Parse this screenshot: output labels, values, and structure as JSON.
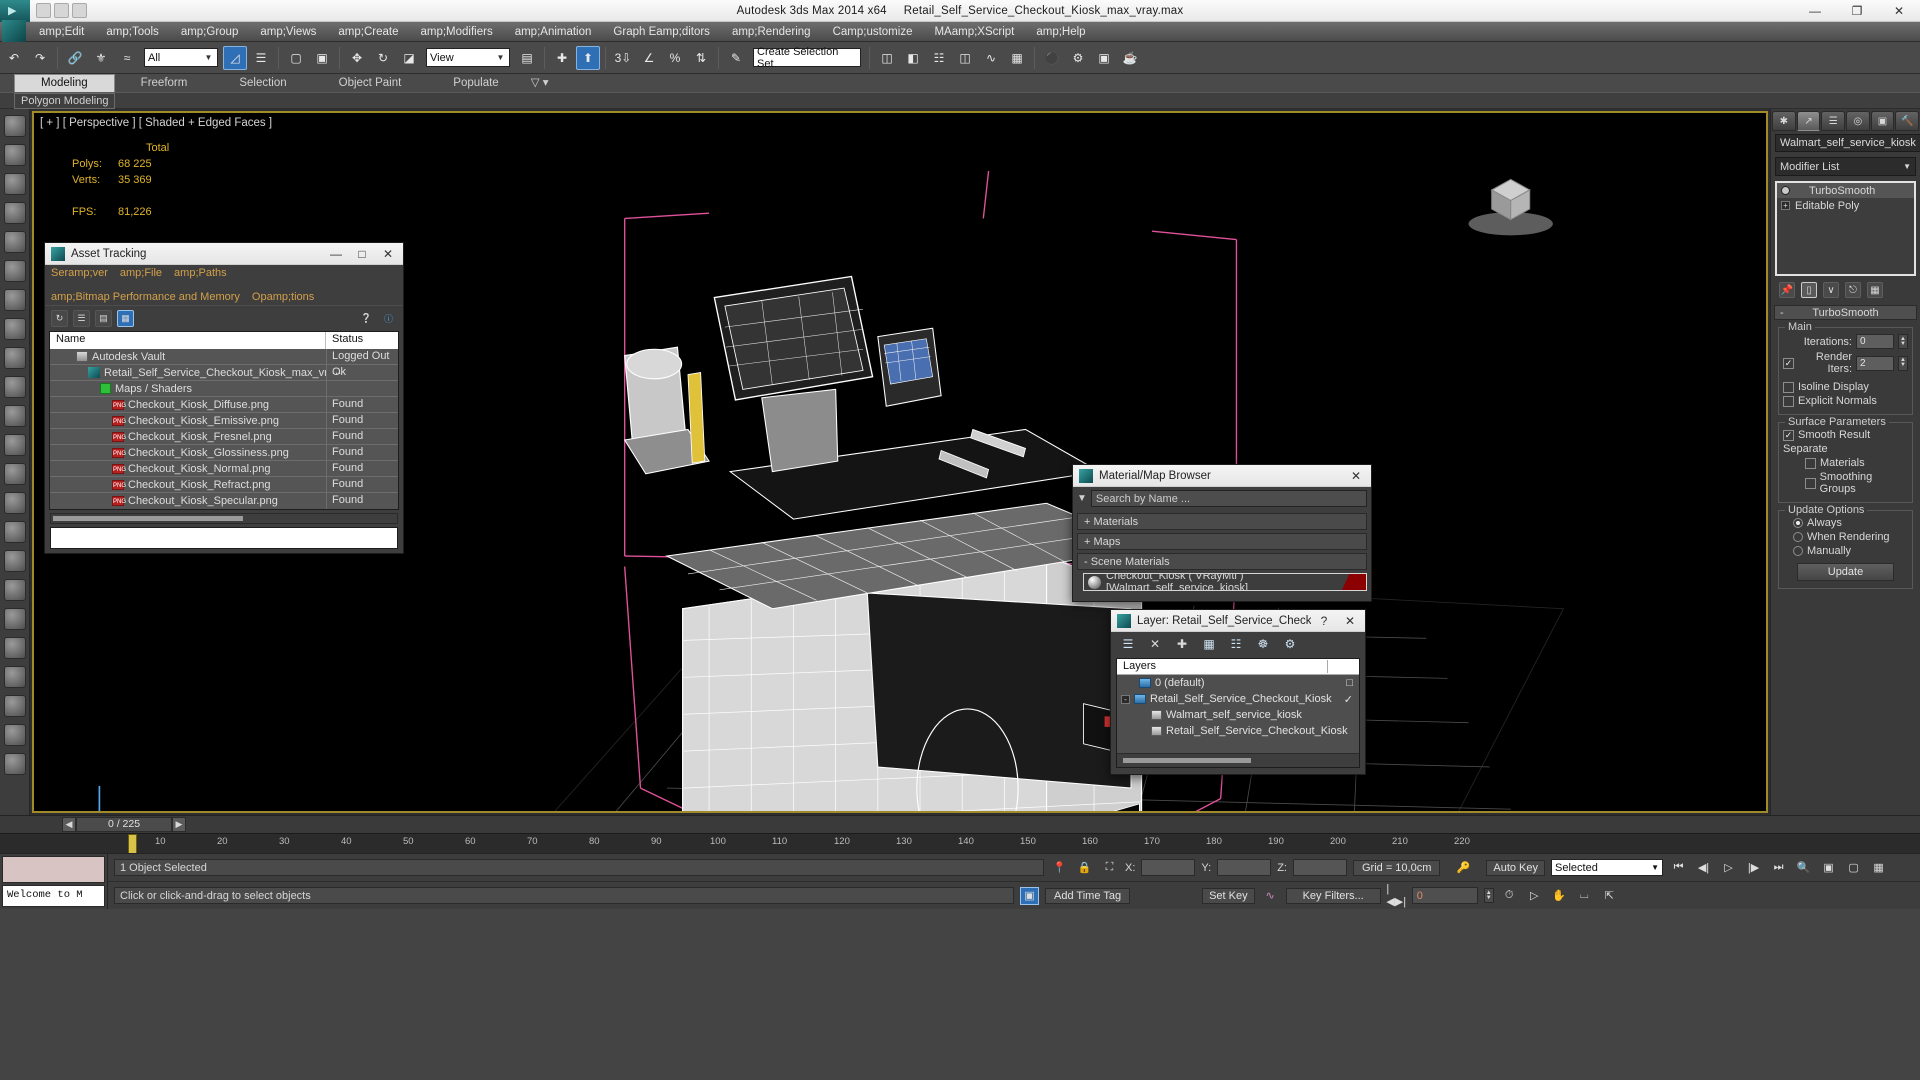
{
  "titlebar": {
    "app_name": "Autodesk 3ds Max  2014 x64",
    "file_name": "Retail_Self_Service_Checkout_Kiosk_max_vray.max",
    "minimize": "—",
    "maximize": "❐",
    "close": "✕"
  },
  "menubar": {
    "items": [
      "amp;Edit",
      "amp;Tools",
      "amp;Group",
      "amp;Views",
      "amp;Create",
      "amp;Modifiers",
      "amp;Animation",
      "Graph Eamp;ditors",
      "amp;Rendering",
      "Camp;ustomize",
      "MAamp;XScript",
      "amp;Help"
    ]
  },
  "toolbar": {
    "selection_filter": "All",
    "reference_coord": "View",
    "named_selection_sets": "Create Selection Set",
    "undo": "undo-icon",
    "redo": "redo-icon",
    "select_link": "link-icon",
    "unlink": "unlink-icon",
    "bind_space_warp": "bind-space-warp-icon",
    "select_object": "select-object-icon",
    "select_by_name": "select-by-name-icon",
    "select_region": "select-region-icon",
    "window_crossing": "window-crossing-icon",
    "select_move": "select-and-move-icon",
    "select_rotate": "select-and-rotate-icon",
    "select_scale": "select-and-scale-icon",
    "use_center": "use-pivot-center-icon",
    "select_manipulate": "select-and-manipulate-icon",
    "snap_toggle": "snaps-toggle-icon",
    "angle_snap": "angle-snap-icon",
    "percent_snap": "percent-snap-icon",
    "spinner_snap": "spinner-snap-icon",
    "mirror": "mirror-icon",
    "align": "align-icon",
    "layer_explorer": "layer-explorer-icon",
    "curve_editor": "curve-editor-icon",
    "schematic_view": "schematic-view-icon",
    "material_editor": "material-editor-icon",
    "render_setup": "render-setup-icon",
    "render_frame": "rendered-frame-window-icon",
    "render_production": "render-production-icon"
  },
  "ribbon": {
    "tabs": [
      "Modeling",
      "Freeform",
      "Selection",
      "Object Paint",
      "Populate"
    ],
    "active_tab": "Modeling",
    "panel_label": "Polygon Modeling"
  },
  "viewport": {
    "label": "[ + ] [ Perspective ] [ Shaded + Edged Faces ]",
    "stats": {
      "header": "Total",
      "rows": [
        {
          "label": "Polys:",
          "value": "68 225"
        },
        {
          "label": "Verts:",
          "value": "35 369"
        },
        {
          "label": "FPS:",
          "value": "81,226"
        }
      ]
    }
  },
  "command_panel": {
    "tabs": [
      "create-tab",
      "modify-tab",
      "hierarchy-tab",
      "motion-tab",
      "display-tab",
      "utilities-tab"
    ],
    "active_tab_index": 1,
    "object_name": "Walmart_self_service_kiosk",
    "modifier_list_label": "Modifier List",
    "modifier_stack": [
      {
        "label": "TurboSmooth",
        "selected": true
      },
      {
        "label": "Editable Poly",
        "selected": false
      }
    ],
    "stack_buttons": [
      "pin-stack-icon",
      "show-end-result-icon",
      "make-unique-icon",
      "remove-modifier-icon",
      "configure-sets-icon"
    ],
    "rollout": {
      "title": "TurboSmooth",
      "collapse_sign": "-",
      "groups": [
        {
          "name": "Main",
          "fields": [
            {
              "label": "Iterations:",
              "value": "0",
              "type": "spinner"
            },
            {
              "label": "Render Iters:",
              "value": "2",
              "type": "spinner",
              "checked": true
            }
          ],
          "checks": [
            {
              "label": "Isoline Display",
              "checked": false
            },
            {
              "label": "Explicit Normals",
              "checked": false
            }
          ]
        },
        {
          "name": "Surface Parameters",
          "checks": [
            {
              "label": "Smooth Result",
              "checked": true
            }
          ],
          "separate_label": "Separate",
          "separate_checks": [
            {
              "label": "Materials",
              "checked": false
            },
            {
              "label": "Smoothing Groups",
              "checked": false
            }
          ]
        },
        {
          "name": "Update Options",
          "radios": [
            {
              "label": "Always",
              "checked": true
            },
            {
              "label": "When Rendering",
              "checked": false
            },
            {
              "label": "Manually",
              "checked": false
            }
          ],
          "button": "Update"
        }
      ]
    }
  },
  "asset_tracking": {
    "title": "Asset Tracking",
    "minimize": "—",
    "maximize": "□",
    "close": "✕",
    "menu": [
      "Seramp;ver",
      "amp;File",
      "amp;Paths",
      "amp;Bitmap Performance and Memory",
      "Opamp;tions"
    ],
    "toolbar_icons": [
      "refresh-icon",
      "list-view-icon",
      "details-view-icon",
      "table-view-icon",
      "help-icon",
      "info-icon"
    ],
    "columns": [
      "Name",
      "Status"
    ],
    "rows": [
      {
        "name": "Autodesk Vault",
        "status": "Logged Out ...",
        "icon": "vault-icon",
        "indent": 1
      },
      {
        "name": "Retail_Self_Service_Checkout_Kiosk_max_vray.max",
        "status": "Ok",
        "icon": "max-file-icon",
        "indent": 2
      },
      {
        "name": "Maps / Shaders",
        "status": "",
        "icon": "shader-icon",
        "indent": 3
      },
      {
        "name": "Checkout_Kiosk_Diffuse.png",
        "status": "Found",
        "icon": "png-icon",
        "indent": 4
      },
      {
        "name": "Checkout_Kiosk_Emissive.png",
        "status": "Found",
        "icon": "png-icon",
        "indent": 4
      },
      {
        "name": "Checkout_Kiosk_Fresnel.png",
        "status": "Found",
        "icon": "png-icon",
        "indent": 4
      },
      {
        "name": "Checkout_Kiosk_Glossiness.png",
        "status": "Found",
        "icon": "png-icon",
        "indent": 4
      },
      {
        "name": "Checkout_Kiosk_Normal.png",
        "status": "Found",
        "icon": "png-icon",
        "indent": 4
      },
      {
        "name": "Checkout_Kiosk_Refract.png",
        "status": "Found",
        "icon": "png-icon",
        "indent": 4
      },
      {
        "name": "Checkout_Kiosk_Specular.png",
        "status": "Found",
        "icon": "png-icon",
        "indent": 4
      }
    ]
  },
  "material_browser": {
    "title": "Material/Map Browser",
    "close": "✕",
    "search_placeholder": "Search by Name ...",
    "groups": [
      {
        "label": "+ Materials"
      },
      {
        "label": "+ Maps"
      },
      {
        "label": "- Scene Materials"
      }
    ],
    "scene_material": "Checkout_Kiosk  ( VRayMtl )  [Walmart_self_service_kiosk]"
  },
  "layer_window": {
    "title": "Layer: Retail_Self_Service_Checko...",
    "help": "?",
    "close": "✕",
    "toolbar_icons": [
      "new-layer-icon",
      "delete-layer-icon",
      "add-layer-icon",
      "select-objects-icon",
      "select-highlighted-icon",
      "highlight-selected-icon",
      "layer-properties-icon"
    ],
    "column_header": "Layers",
    "rows": [
      {
        "label": "0 (default)",
        "type": "layer",
        "indent": 1,
        "mark": "□"
      },
      {
        "label": "Retail_Self_Service_Checkout_Kiosk",
        "type": "layer",
        "indent": 0,
        "mark": "✓",
        "expander": "-"
      },
      {
        "label": "Walmart_self_service_kiosk",
        "type": "object",
        "indent": 2,
        "mark": ""
      },
      {
        "label": "Retail_Self_Service_Checkout_Kiosk",
        "type": "object",
        "indent": 2,
        "mark": ""
      }
    ]
  },
  "timeline": {
    "frame_display": "0 / 225",
    "prev_key": "◀",
    "next_key": "▶",
    "ticks": [
      "10",
      "20",
      "30",
      "40",
      "50",
      "60",
      "70",
      "80",
      "90",
      "100",
      "110",
      "120",
      "130",
      "140",
      "150",
      "160",
      "170",
      "180",
      "190",
      "200",
      "210",
      "220"
    ]
  },
  "statusbar": {
    "mini_listener_text": "Welcome to M",
    "selection_status": "1 Object Selected",
    "prompt": "Click or click-and-drag to select objects",
    "coords": [
      {
        "label": "X:",
        "value": ""
      },
      {
        "label": "Y:",
        "value": ""
      },
      {
        "label": "Z:",
        "value": ""
      }
    ],
    "grid": "Grid = 10,0cm",
    "add_time_tag": "Add Time Tag",
    "auto_key": "Auto Key",
    "set_key": "Set Key",
    "key_mode": "Selected",
    "key_filters": "Key Filters...",
    "current_frame": "0",
    "toggle_icons": [
      "pin-stack-icon",
      "lock-selection-icon",
      "absolute-relative-icon"
    ],
    "anim_buttons": [
      "go-to-start-icon",
      "prev-frame-icon",
      "play-icon",
      "next-frame-icon",
      "go-to-end-icon"
    ],
    "nav_buttons": [
      "zoom-icon",
      "zoom-all-icon",
      "zoom-extents-icon",
      "zoom-extents-all-icon",
      "field-of-view-icon",
      "pan-icon",
      "orbit-icon",
      "maximize-viewport-icon"
    ],
    "key_toggle_icon": "key-toggle-icon"
  },
  "colors": {
    "accent_gold": "#e0b429",
    "viewport_border": "#a08a2a",
    "panel_bg": "#3a3a3a",
    "toolbar_bg": "#4a4a4a",
    "selected_blue": "#2f6fb5",
    "menu_text": "#d3a04a",
    "material_red": "#8b0000"
  }
}
